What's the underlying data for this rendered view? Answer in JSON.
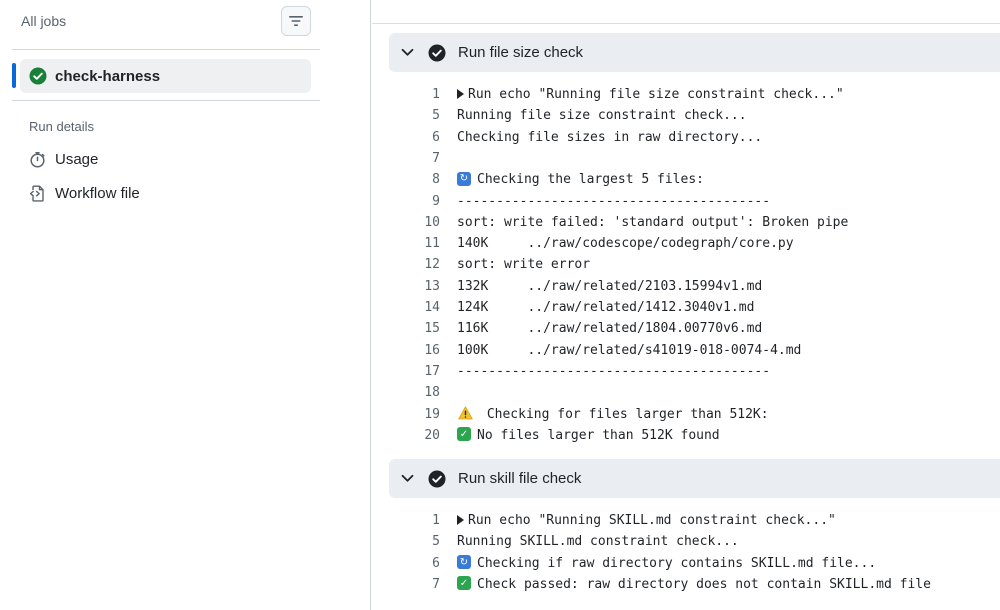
{
  "sidebar": {
    "header": "All jobs",
    "job": {
      "label": "check-harness",
      "status": "success"
    },
    "section_title": "Run details",
    "links": [
      {
        "label": "Usage",
        "icon": "stopwatch-icon"
      },
      {
        "label": "Workflow file",
        "icon": "file-code-icon"
      }
    ]
  },
  "steps": [
    {
      "title": "Run file size check",
      "lines": [
        {
          "n": "1",
          "text": "Run echo \"Running file size constraint check...\"",
          "prefix": "triangle"
        },
        {
          "n": "5",
          "text": "Running file size constraint check..."
        },
        {
          "n": "6",
          "text": "Checking file sizes in raw directory..."
        },
        {
          "n": "7",
          "text": ""
        },
        {
          "n": "8",
          "text": "Checking the largest 5 files:",
          "prefix": "loop"
        },
        {
          "n": "9",
          "text": "----------------------------------------"
        },
        {
          "n": "10",
          "text": "sort: write failed: 'standard output': Broken pipe"
        },
        {
          "n": "11",
          "text": "140K     ../raw/codescope/codegraph/core.py"
        },
        {
          "n": "12",
          "text": "sort: write error"
        },
        {
          "n": "13",
          "text": "132K     ../raw/related/2103.15994v1.md"
        },
        {
          "n": "14",
          "text": "124K     ../raw/related/1412.3040v1.md"
        },
        {
          "n": "15",
          "text": "116K     ../raw/related/1804.00770v6.md"
        },
        {
          "n": "16",
          "text": "100K     ../raw/related/s41019-018-0074-4.md"
        },
        {
          "n": "17",
          "text": "----------------------------------------"
        },
        {
          "n": "18",
          "text": ""
        },
        {
          "n": "19",
          "text": " Checking for files larger than 512K:",
          "prefix": "warn"
        },
        {
          "n": "20",
          "text": "No files larger than 512K found",
          "prefix": "check"
        }
      ]
    },
    {
      "title": "Run skill file check",
      "lines": [
        {
          "n": "1",
          "text": "Run echo \"Running SKILL.md constraint check...\"",
          "prefix": "triangle"
        },
        {
          "n": "5",
          "text": "Running SKILL.md constraint check..."
        },
        {
          "n": "6",
          "text": "Checking if raw directory contains SKILL.md file...",
          "prefix": "loop"
        },
        {
          "n": "7",
          "text": "Check passed: raw directory does not contain SKILL.md file",
          "prefix": "check"
        }
      ]
    }
  ],
  "colors": {
    "success": "#1a7f37",
    "accent": "#0969da",
    "step_header_bg": "#eaeef2"
  }
}
